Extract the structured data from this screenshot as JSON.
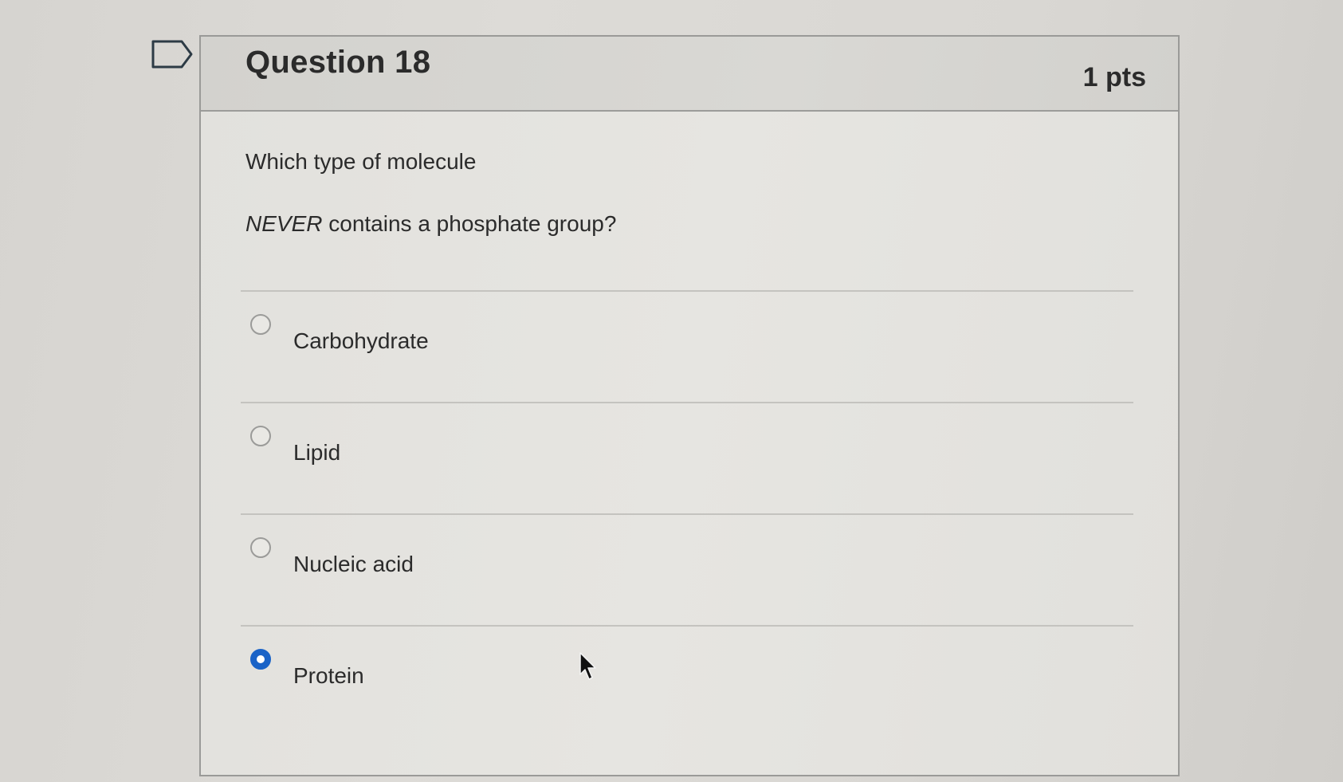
{
  "question": {
    "title": "Question 18",
    "points": "1 pts",
    "text_line1": "Which type of molecule",
    "text_line2_emphasis": "NEVER",
    "text_line2_rest": " contains a phosphate group?"
  },
  "answers": [
    {
      "label": "Carbohydrate",
      "selected": false
    },
    {
      "label": "Lipid",
      "selected": false
    },
    {
      "label": "Nucleic acid",
      "selected": false
    },
    {
      "label": "Protein",
      "selected": true
    }
  ],
  "colors": {
    "radio_selected": "#1a63c7",
    "card_border": "#9a9a98"
  },
  "icons": {
    "flag": "flag-icon",
    "cursor": "mouse-pointer-icon"
  }
}
